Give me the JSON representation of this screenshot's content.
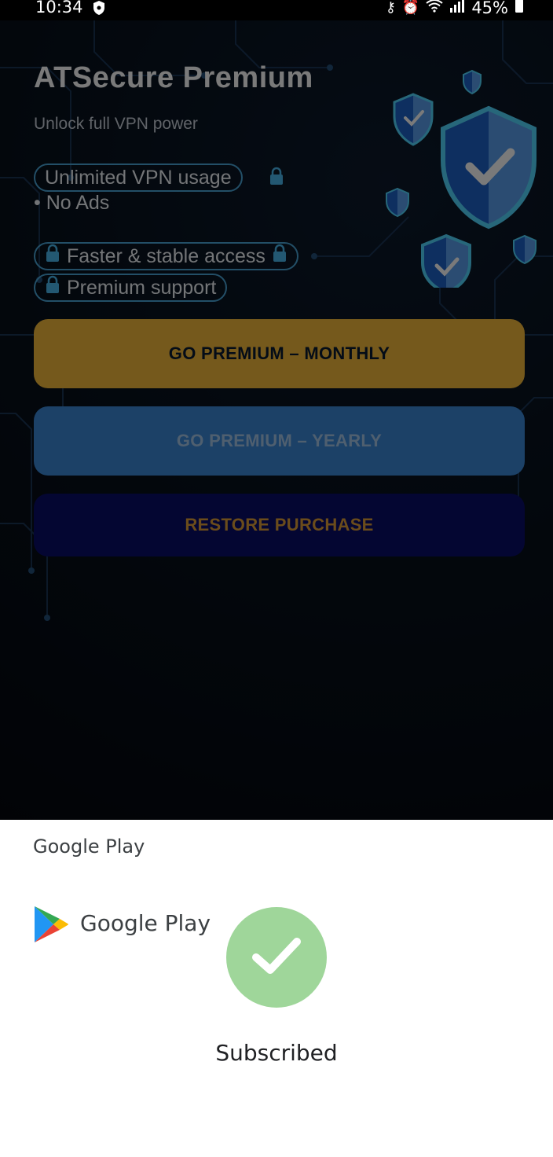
{
  "status_bar": {
    "time": "10:34",
    "battery": "45%",
    "icons": [
      "shield-icon",
      "key-icon",
      "alarm-icon",
      "wifi-icon",
      "signal-icon",
      "battery-icon"
    ]
  },
  "app": {
    "title": "ATSecure Premium",
    "subtitle": "Unlock full VPN power",
    "features": {
      "unlimited": "Unlimited VPN usage",
      "no_ads": "• No Ads",
      "faster": "Faster & stable access",
      "support": "Premium support"
    },
    "buttons": {
      "monthly": "GO PREMIUM – MONTHLY",
      "yearly": "GO PREMIUM – YEARLY",
      "restore": "RESTORE PURCHASE"
    },
    "colors": {
      "monthly_button": "#f5bb3c",
      "yearly_button": "#3b88d8",
      "restore_button": "#0a0e6a",
      "accent": "#4ab8ee"
    }
  },
  "sheet": {
    "header": "Google Play",
    "brand": "Google Play",
    "status": "Subscribed",
    "status_color": "#9fd69a"
  }
}
